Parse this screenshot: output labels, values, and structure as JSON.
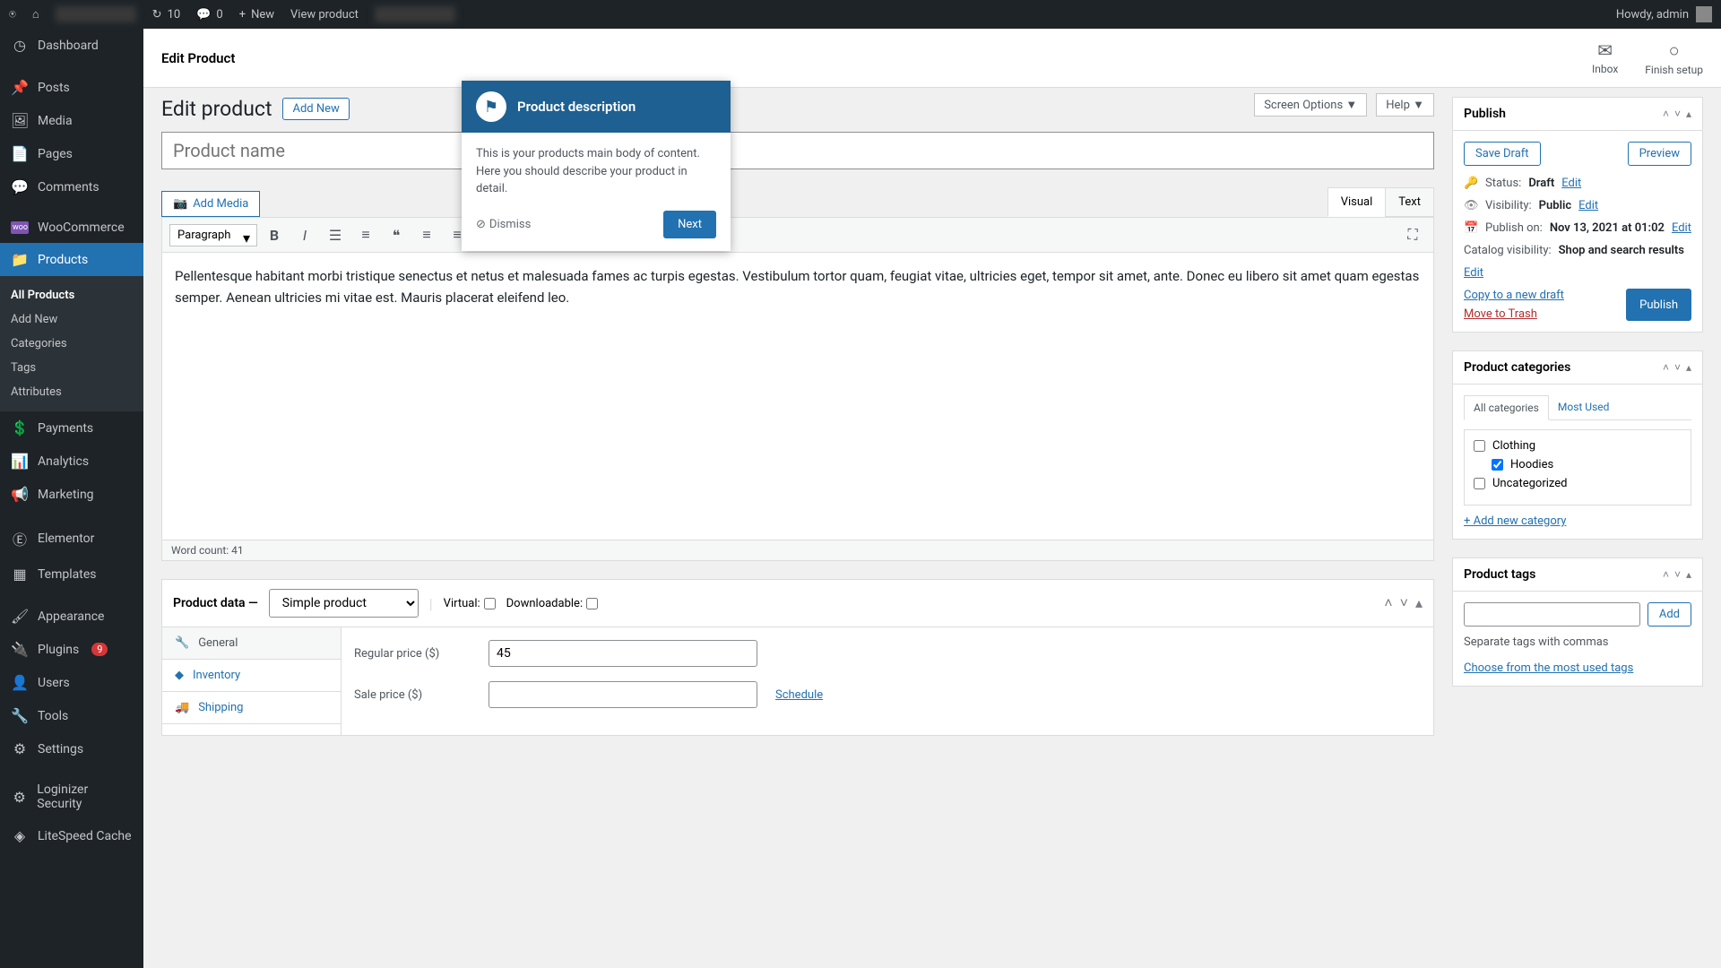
{
  "adminBar": {
    "updates": "10",
    "comments": "0",
    "new": "New",
    "viewProduct": "View product",
    "howdy": "Howdy, admin"
  },
  "sidebar": {
    "dashboard": "Dashboard",
    "posts": "Posts",
    "media": "Media",
    "pages": "Pages",
    "comments": "Comments",
    "woocommerce": "WooCommerce",
    "products": "Products",
    "productsSub": {
      "allProducts": "All Products",
      "addNew": "Add New",
      "categories": "Categories",
      "tags": "Tags",
      "attributes": "Attributes"
    },
    "payments": "Payments",
    "analytics": "Analytics",
    "marketing": "Marketing",
    "elementor": "Elementor",
    "templates": "Templates",
    "appearance": "Appearance",
    "plugins": "Plugins",
    "pluginsBadge": "9",
    "users": "Users",
    "tools": "Tools",
    "settings": "Settings",
    "loginizer": "Loginizer Security",
    "litespeed": "LiteSpeed Cache"
  },
  "header": {
    "breadcrumb": "Edit Product",
    "inbox": "Inbox",
    "finishSetup": "Finish setup"
  },
  "page": {
    "title": "Edit product",
    "addNew": "Add New",
    "screenOptions": "Screen Options ▼",
    "help": "Help ▼"
  },
  "titleInput": {
    "placeholder": "Product name"
  },
  "editor": {
    "addMedia": "Add Media",
    "tabVisual": "Visual",
    "tabText": "Text",
    "formatSelect": "Paragraph",
    "body": "Pellentesque habitant morbi tristique senectus et netus et malesuada fames ac turpis egestas. Vestibulum tortor quam, feugiat vitae, ultricies eget, tempor sit amet, ante. Donec eu libero sit amet quam egestas semper. Aenean ultricies mi vitae est. Mauris placerat eleifend leo.",
    "wordCount": "Word count: 41"
  },
  "tour": {
    "title": "Product description",
    "body": "This is your products main body of content. Here you should describe your product in detail.",
    "dismiss": "Dismiss",
    "next": "Next"
  },
  "productData": {
    "heading": "Product data —",
    "typeSelect": "Simple product",
    "virtual": "Virtual:",
    "downloadable": "Downloadable:",
    "tabs": {
      "general": "General",
      "inventory": "Inventory",
      "shipping": "Shipping"
    },
    "regularPriceLabel": "Regular price ($)",
    "regularPriceValue": "45",
    "salePriceLabel": "Sale price ($)",
    "salePriceValue": "",
    "schedule": "Schedule"
  },
  "publish": {
    "title": "Publish",
    "saveDraft": "Save Draft",
    "preview": "Preview",
    "statusLabel": "Status:",
    "statusValue": "Draft",
    "visibilityLabel": "Visibility:",
    "visibilityValue": "Public",
    "publishOnLabel": "Publish on:",
    "publishOnValue": "Nov 13, 2021 at 01:02",
    "catalogLabel": "Catalog visibility:",
    "catalogValue": "Shop and search results",
    "edit": "Edit",
    "copyDraft": "Copy to a new draft",
    "moveTrash": "Move to Trash",
    "publishBtn": "Publish"
  },
  "categories": {
    "title": "Product categories",
    "tabAll": "All categories",
    "tabMost": "Most Used",
    "items": {
      "clothing": "Clothing",
      "hoodies": "Hoodies",
      "uncategorized": "Uncategorized"
    },
    "addNew": "+ Add new category"
  },
  "tags": {
    "title": "Product tags",
    "addBtn": "Add",
    "separateHelp": "Separate tags with commas",
    "chooseMost": "Choose from the most used tags"
  }
}
